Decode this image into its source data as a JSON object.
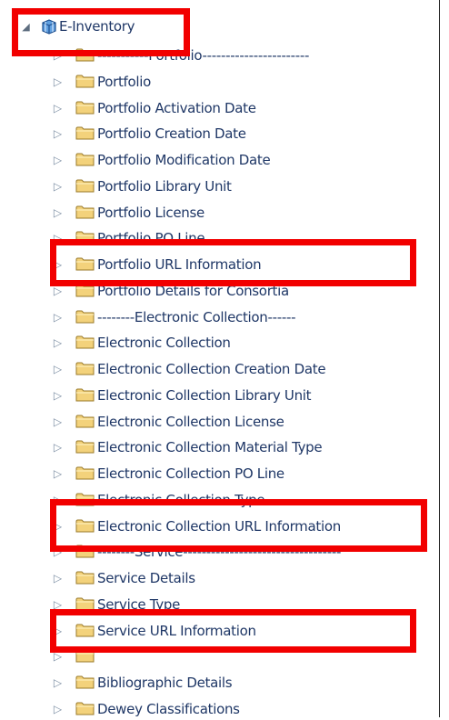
{
  "tree": {
    "root": {
      "label": "E-Inventory",
      "icon": "cube-subject-area-icon",
      "expander": "collapse-triangle-icon"
    },
    "items": [
      {
        "label": "-----------Portfolio-----------------------",
        "name": "folder-portfolio-separator"
      },
      {
        "label": "Portfolio",
        "name": "folder-portfolio"
      },
      {
        "label": "Portfolio Activation Date",
        "name": "folder-portfolio-activation-date"
      },
      {
        "label": "Portfolio Creation Date",
        "name": "folder-portfolio-creation-date"
      },
      {
        "label": "Portfolio Modification Date",
        "name": "folder-portfolio-modification-date"
      },
      {
        "label": "Portfolio Library Unit",
        "name": "folder-portfolio-library-unit"
      },
      {
        "label": "Portfolio License",
        "name": "folder-portfolio-license"
      },
      {
        "label": "Portfolio PO Line",
        "name": "folder-portfolio-po-line"
      },
      {
        "label": "Portfolio URL Information",
        "name": "folder-portfolio-url-information"
      },
      {
        "label": "Portfolio Details for Consortia",
        "name": "folder-portfolio-details-for-consortia"
      },
      {
        "label": "--------Electronic Collection------",
        "name": "folder-electronic-collection-separator"
      },
      {
        "label": "Electronic Collection",
        "name": "folder-electronic-collection"
      },
      {
        "label": "Electronic Collection Creation Date",
        "name": "folder-electronic-collection-creation-date"
      },
      {
        "label": "Electronic Collection Library Unit",
        "name": "folder-electronic-collection-library-unit"
      },
      {
        "label": "Electronic Collection License",
        "name": "folder-electronic-collection-license"
      },
      {
        "label": "Electronic Collection Material Type",
        "name": "folder-electronic-collection-material-type"
      },
      {
        "label": "Electronic Collection PO Line",
        "name": "folder-electronic-collection-po-line"
      },
      {
        "label": "Electronic Collection Type",
        "name": "folder-electronic-collection-type"
      },
      {
        "label": "Electronic Collection URL Information",
        "name": "folder-electronic-collection-url-information"
      },
      {
        "label": "--------Service----------------------------------",
        "name": "folder-service-separator"
      },
      {
        "label": "Service Details",
        "name": "folder-service-details"
      },
      {
        "label": "Service Type",
        "name": "folder-service-type"
      },
      {
        "label": "Service URL Information",
        "name": "folder-service-url-information"
      },
      {
        "label": "",
        "name": "folder-hidden"
      },
      {
        "label": "Bibliographic Details",
        "name": "folder-bibliographic-details"
      },
      {
        "label": "Dewey Classifications",
        "name": "folder-dewey-classifications"
      }
    ]
  },
  "icons": {
    "folder": "folder-icon",
    "expander": "expand-triangle-icon"
  },
  "colors": {
    "highlight": "#f20000",
    "label": "#1f3766",
    "folder_fill": "#f3d27b",
    "folder_stroke": "#9a7a2a",
    "cube": "#2f6fb5"
  }
}
